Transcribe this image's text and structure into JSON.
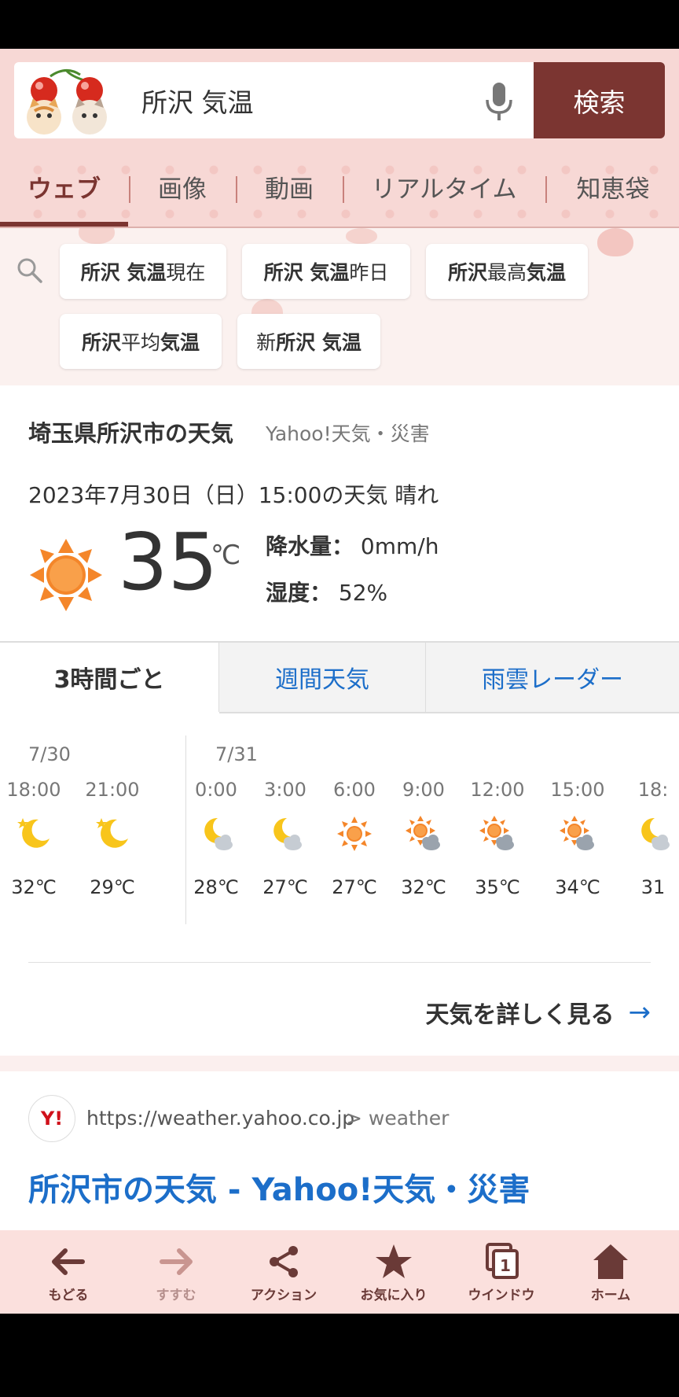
{
  "search": {
    "query": "所沢 気温",
    "button_label": "検索"
  },
  "tabs": [
    {
      "label": "ウェブ"
    },
    {
      "label": "画像"
    },
    {
      "label": "動画"
    },
    {
      "label": "リアルタイム"
    },
    {
      "label": "知恵袋"
    }
  ],
  "suggestions": [
    {
      "bold": "所沢 気温",
      "rest": " 現在"
    },
    {
      "bold": "所沢 気温",
      "rest": " 昨日"
    },
    {
      "bold": "所沢",
      "rest": " 最高",
      "bold2": "気温"
    },
    {
      "bold": "所沢",
      "rest": " 平均",
      "bold2": "気温"
    },
    {
      "prefix": "新",
      "bold": "所沢 気温"
    }
  ],
  "weather": {
    "title": "埼玉県所沢市の天気",
    "source": "Yahoo!天気・災害",
    "date_line": "2023年7月30日（日）15:00の天気 晴れ",
    "temp": "35",
    "unit": "℃",
    "precip_label": "降水量：",
    "precip_value": " 0mm/h",
    "humidity_label": "湿度：",
    "humidity_value": " 52%",
    "tabs": [
      "3時間ごと",
      "週間天気",
      "雨雲レーダー"
    ],
    "dates": [
      "7/30",
      "7/31"
    ],
    "slots": [
      {
        "time": "18:00",
        "icon": "moon-icon",
        "temp": "32℃"
      },
      {
        "time": "21:00",
        "icon": "moon-icon",
        "temp": "29℃"
      },
      {
        "time": "0:00",
        "icon": "moon-cloud-icon",
        "temp": "28℃"
      },
      {
        "time": "3:00",
        "icon": "moon-cloud-icon",
        "temp": "27℃"
      },
      {
        "time": "6:00",
        "icon": "sun-icon",
        "temp": "27℃"
      },
      {
        "time": "9:00",
        "icon": "sun-cloud-icon",
        "temp": "32℃"
      },
      {
        "time": "12:00",
        "icon": "sun-cloud-icon",
        "temp": "35℃"
      },
      {
        "time": "15:00",
        "icon": "sun-cloud-icon",
        "temp": "34℃"
      },
      {
        "time": "18:",
        "icon": "moon-cloud-icon",
        "temp": "31"
      }
    ],
    "more_label": "天気を詳しく見る",
    "more_arrow": "→"
  },
  "result": {
    "favicon": "Y!",
    "url": "https://weather.yahoo.co.jp",
    "crumb": ">  weather",
    "title": "所沢市の天気 - Yahoo!天気・災害"
  },
  "bottom_nav": [
    {
      "label": "もどる",
      "icon": "back-arrow-icon"
    },
    {
      "label": "すすむ",
      "icon": "forward-arrow-icon"
    },
    {
      "label": "アクション",
      "icon": "share-icon"
    },
    {
      "label": "お気に入り",
      "icon": "star-icon"
    },
    {
      "label": "ウインドウ",
      "icon": "window-icon",
      "badge": "1"
    },
    {
      "label": "ホーム",
      "icon": "home-icon"
    }
  ],
  "colors": {
    "brand": "#7b3531",
    "header_bg": "#f7d8d5",
    "link": "#1c6ec9",
    "sun": "#f4862a",
    "moon": "#f8c51b"
  }
}
